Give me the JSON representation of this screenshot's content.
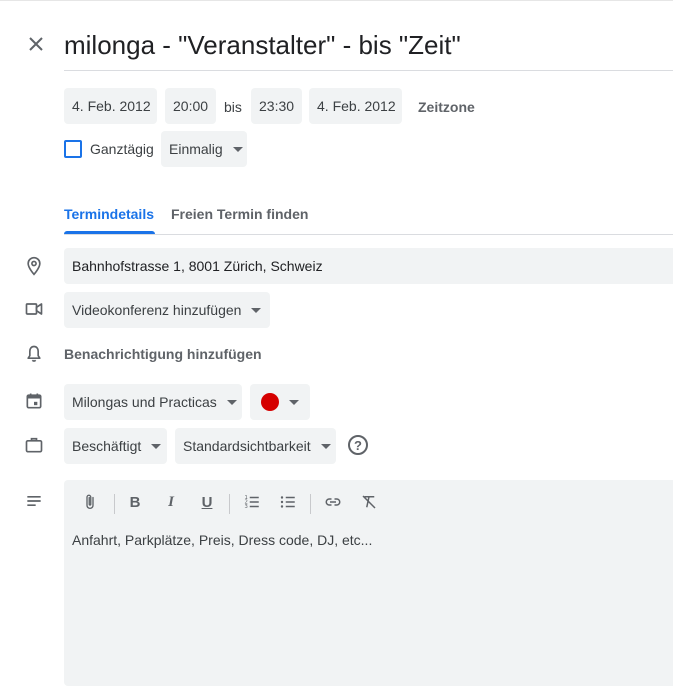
{
  "title": "milonga - \"Veranstalter\" - bis \"Zeit\"",
  "datetime": {
    "start_date": "4. Feb. 2012",
    "start_time": "20:00",
    "separator": "bis",
    "end_time": "23:30",
    "end_date": "4. Feb. 2012",
    "timezone_label": "Zeitzone"
  },
  "allday": {
    "label": "Ganztägig",
    "checked": false
  },
  "recurrence": {
    "value": "Einmalig"
  },
  "tabs": [
    {
      "label": "Termindetails",
      "active": true
    },
    {
      "label": "Freien Termin finden",
      "active": false
    }
  ],
  "location": {
    "value": "Bahnhofstrasse 1, 8001 Zürich, Schweiz"
  },
  "videoconf": {
    "label": "Videokonferenz hinzufügen"
  },
  "notification": {
    "label": "Benachrichtigung hinzufügen"
  },
  "calendar": {
    "name": "Milongas und Practicas",
    "color": "#d50000"
  },
  "availability": {
    "value": "Beschäftigt"
  },
  "visibility": {
    "value": "Standardsichtbarkeit"
  },
  "description": {
    "placeholder": "Anfahrt, Parkplätze, Preis, Dress code, DJ, etc...",
    "toolbar": [
      "attachment-icon",
      "bold-icon",
      "italic-icon",
      "underline-icon",
      "numbered-list-icon",
      "bulleted-list-icon",
      "link-icon",
      "remove-formatting-icon"
    ]
  },
  "colors": {
    "accent": "#1a73e8",
    "field_bg": "#f1f3f4",
    "text": "#3c4043"
  }
}
